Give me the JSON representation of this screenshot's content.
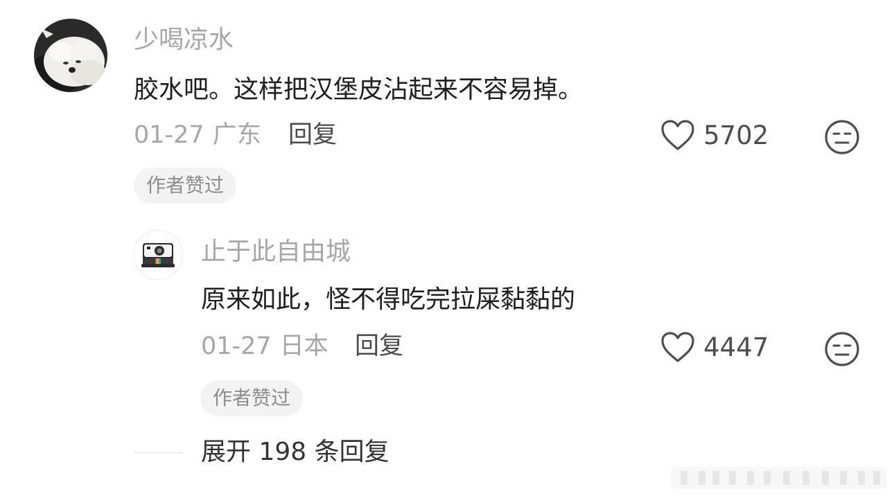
{
  "comments": [
    {
      "username": "少喝凉水",
      "text": "胶水吧。这样把汉堡皮沾起来不容易掉。",
      "date": "01-27",
      "location": "广东",
      "reply_label": "回复",
      "likes": "5702",
      "badge": "作者赞过",
      "avatar_icon": "dog-avatar"
    },
    {
      "username": "止于此自由城",
      "text": "原来如此，怪不得吃完拉屎黏黏的",
      "date": "01-27",
      "location": "日本",
      "reply_label": "回复",
      "likes": "4447",
      "badge": "作者赞过",
      "avatar_icon": "camera-avatar"
    }
  ],
  "expand_replies": "展开 198 条回复",
  "colors": {
    "username": "#a6a6a6",
    "text": "#1f1f1f",
    "meta": "#a6a6a6",
    "badge_bg": "#f3f3f3"
  }
}
